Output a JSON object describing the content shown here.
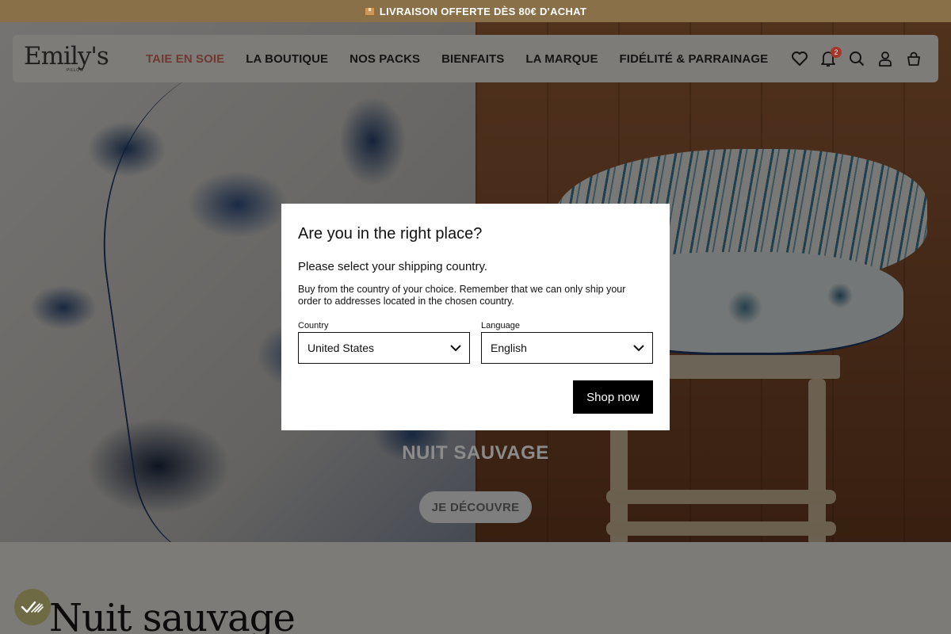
{
  "promo_bar": {
    "text": "LIVRAISON OFFERTE DÈS 80€ D'ACHAT",
    "icon": "package-icon"
  },
  "header": {
    "logo": "Emily's",
    "logo_sub": "PILLOW",
    "nav": [
      {
        "label": "TAIE EN SOIE",
        "active": true
      },
      {
        "label": "LA BOUTIQUE"
      },
      {
        "label": "NOS PACKS"
      },
      {
        "label": "BIENFAITS"
      },
      {
        "label": "LA MARQUE"
      },
      {
        "label": "FIDÉLITÉ & PARRAINAGE"
      }
    ],
    "icons": [
      "heart-icon",
      "bell-icon",
      "search-icon",
      "account-icon",
      "bag-icon"
    ],
    "notification_count": "2"
  },
  "hero": {
    "title": "NUIT SAUVAGE",
    "cta": "JE DÉCOUVRE"
  },
  "section": {
    "title": "Nuit sauvage"
  },
  "modal": {
    "title": "Are you in the right place?",
    "subtitle": "Please select your shipping country.",
    "description": "Buy from the country of your choice. Remember that we can only ship your order to addresses located in the chosen country.",
    "country_label": "Country",
    "country_value": "United States",
    "language_label": "Language",
    "language_value": "English",
    "submit": "Shop now"
  },
  "consent_button": {
    "icon": "privacy-check-icon"
  },
  "colors": {
    "accent": "#6e3a32",
    "promo": "#8a7048",
    "badge": "#a6352c",
    "button": "#000000"
  }
}
